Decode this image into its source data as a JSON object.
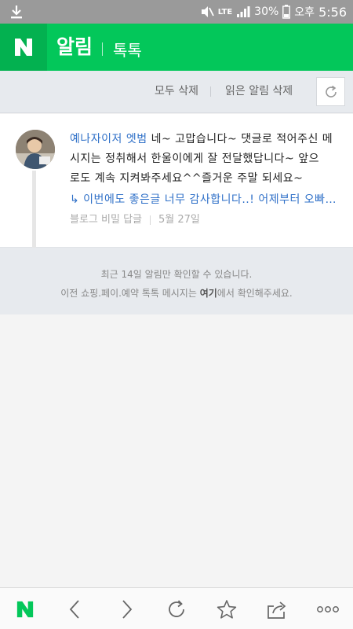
{
  "statusbar": {
    "network": "LTE",
    "battery": "30%",
    "ampm": "오후",
    "time": "5:56",
    "icons": [
      "download-icon",
      "mute-icon",
      "signal-icon",
      "battery-icon"
    ]
  },
  "header": {
    "logo": "N",
    "title": "알림",
    "tab": "톡톡",
    "color": "#03c75a"
  },
  "actions": {
    "delete_all": "모두 삭제",
    "delete_read": "읽은 알림 삭제",
    "refresh_icon": "refresh-icon"
  },
  "notification": {
    "author": "예나자이저 엣범",
    "text_line1": " 네~ 고맙습니다~ 댓글로 적어주신 메",
    "text_line2": "시지는 정취해서 한울이에게 잘 전달했답니다~ 앞으",
    "text_line3": "로도 계속 지켜봐주세요^^즐거운 주말 되세요~",
    "reply": "↳ 이번에도 좋은글 너무 감사합니다..! 어제부터 오빠…",
    "source": "블로그 비밀 답글",
    "date": "5월 27일",
    "link_color": "#2f70c8"
  },
  "info": {
    "line1": "최근 14일 알림만 확인할 수 있습니다.",
    "line2_pre": "이전 쇼핑.페이.예약 톡톡 메시지는 ",
    "line2_link": "여기",
    "line2_post": "에서 확인해주세요."
  },
  "bottombar": {
    "items": [
      "naver-home-icon",
      "back-icon",
      "forward-icon",
      "refresh-icon",
      "bookmark-star-icon",
      "share-icon",
      "more-icon"
    ]
  }
}
